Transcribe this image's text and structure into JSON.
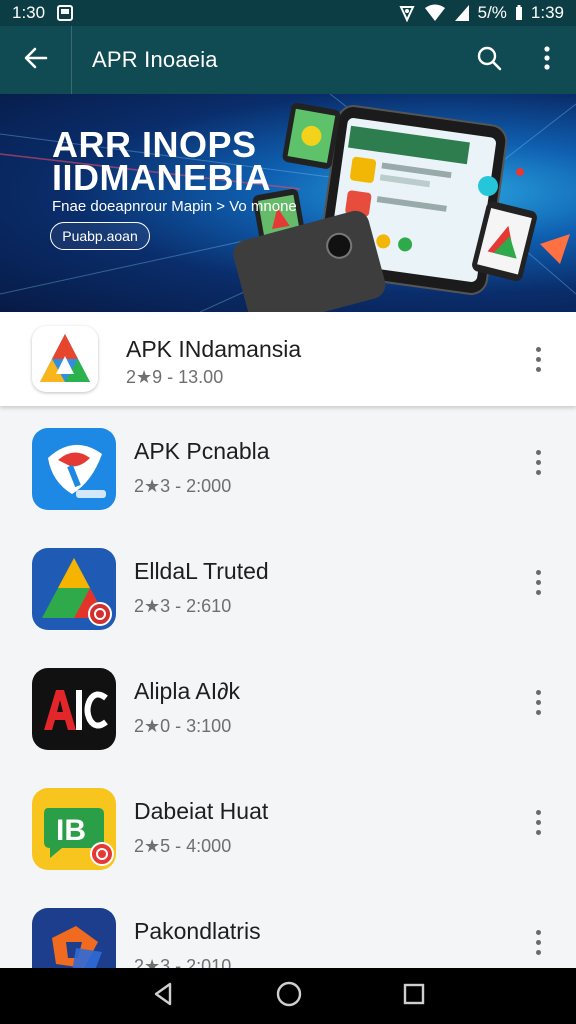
{
  "status_bar": {
    "time_left": "1:30",
    "battery_percent": "5/%",
    "time_right": "1:39",
    "icons": [
      "notification-icon",
      "signal-icon",
      "wifi-icon",
      "battery-icon"
    ]
  },
  "app_bar": {
    "title": "APR Inoaeia",
    "icons": [
      "back-arrow-icon",
      "search-icon",
      "more-vert-icon"
    ]
  },
  "banner": {
    "title_line1": "ARR INOPS",
    "title_line2": "IIDMANEBIA",
    "subtitle": "Fnae doeapnrour Mapin > Vo mnone",
    "button_label": "Puabp.aoan"
  },
  "apps": [
    {
      "name": "APK INdamansia",
      "meta": "2★9 - 13.00",
      "icon": "apk-triangle-logo-icon",
      "colors": [
        "#e8462c",
        "#f8b51c",
        "#2f8fe0",
        "#2bb24c"
      ]
    },
    {
      "name": "APK Pcnabla",
      "meta": "2★3 - 2:000",
      "icon": "blue-shield-app-icon",
      "colors": [
        "#1e88e5",
        "#e53935"
      ]
    },
    {
      "name": "ElldaL Truted",
      "meta": "2★3 - 2:610",
      "icon": "triangle-app-icon",
      "colors": [
        "#1f5bb5",
        "#e3342c",
        "#f5b400",
        "#2eaa4a"
      ]
    },
    {
      "name": "Alipla AI∂k",
      "meta": "2★0 - 3:100",
      "icon": "alc-app-icon",
      "colors": [
        "#111111",
        "#e2262a"
      ]
    },
    {
      "name": "Dabeiat Huat",
      "meta": "2★5 - 4:000",
      "icon": "ib-chat-app-icon",
      "colors": [
        "#f7c51e",
        "#2a9f48",
        "#e53935"
      ]
    },
    {
      "name": "Pakondlatris",
      "meta": "2★3 - 2:010",
      "icon": "orange-blue-app-icon",
      "colors": [
        "#1d3e8c",
        "#f06a1f"
      ]
    }
  ],
  "nav_bar": {
    "icons": [
      "back-nav-icon",
      "home-nav-icon",
      "recents-nav-icon"
    ]
  }
}
